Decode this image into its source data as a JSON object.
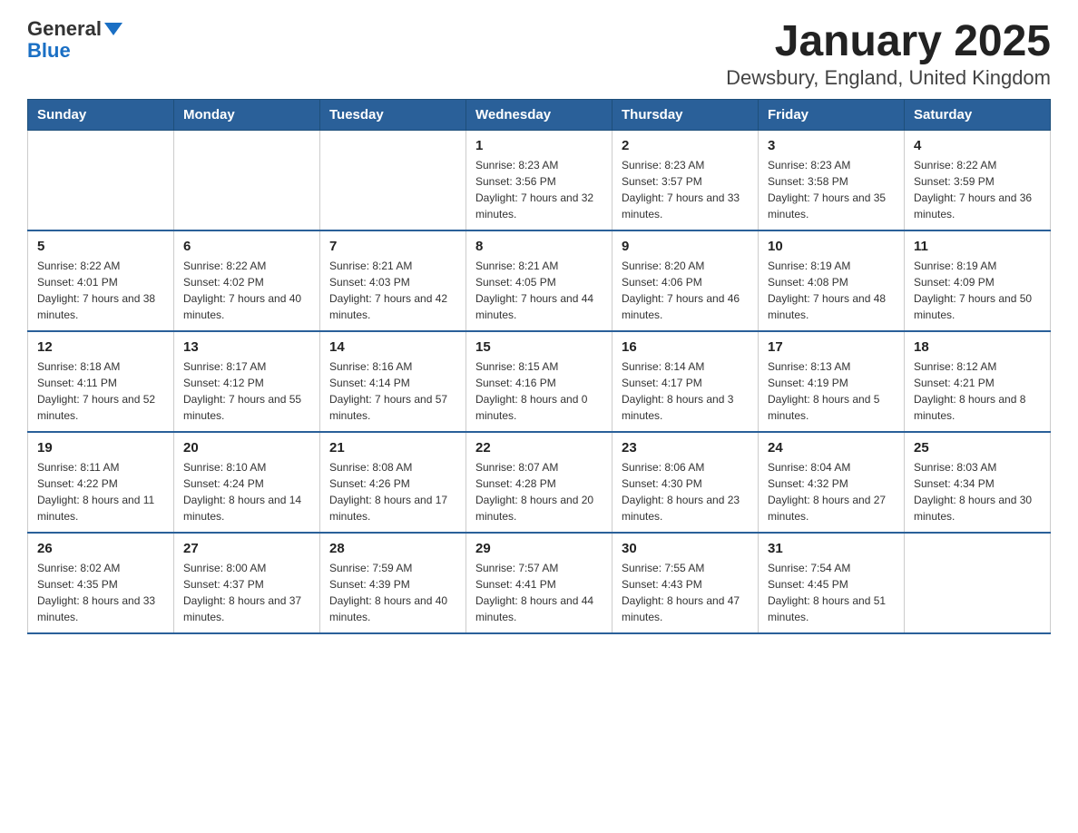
{
  "logo": {
    "general": "General",
    "blue": "Blue"
  },
  "title": "January 2025",
  "subtitle": "Dewsbury, England, United Kingdom",
  "days_of_week": [
    "Sunday",
    "Monday",
    "Tuesday",
    "Wednesday",
    "Thursday",
    "Friday",
    "Saturday"
  ],
  "weeks": [
    [
      {
        "day": "",
        "info": ""
      },
      {
        "day": "",
        "info": ""
      },
      {
        "day": "",
        "info": ""
      },
      {
        "day": "1",
        "info": "Sunrise: 8:23 AM\nSunset: 3:56 PM\nDaylight: 7 hours and 32 minutes."
      },
      {
        "day": "2",
        "info": "Sunrise: 8:23 AM\nSunset: 3:57 PM\nDaylight: 7 hours and 33 minutes."
      },
      {
        "day": "3",
        "info": "Sunrise: 8:23 AM\nSunset: 3:58 PM\nDaylight: 7 hours and 35 minutes."
      },
      {
        "day": "4",
        "info": "Sunrise: 8:22 AM\nSunset: 3:59 PM\nDaylight: 7 hours and 36 minutes."
      }
    ],
    [
      {
        "day": "5",
        "info": "Sunrise: 8:22 AM\nSunset: 4:01 PM\nDaylight: 7 hours and 38 minutes."
      },
      {
        "day": "6",
        "info": "Sunrise: 8:22 AM\nSunset: 4:02 PM\nDaylight: 7 hours and 40 minutes."
      },
      {
        "day": "7",
        "info": "Sunrise: 8:21 AM\nSunset: 4:03 PM\nDaylight: 7 hours and 42 minutes."
      },
      {
        "day": "8",
        "info": "Sunrise: 8:21 AM\nSunset: 4:05 PM\nDaylight: 7 hours and 44 minutes."
      },
      {
        "day": "9",
        "info": "Sunrise: 8:20 AM\nSunset: 4:06 PM\nDaylight: 7 hours and 46 minutes."
      },
      {
        "day": "10",
        "info": "Sunrise: 8:19 AM\nSunset: 4:08 PM\nDaylight: 7 hours and 48 minutes."
      },
      {
        "day": "11",
        "info": "Sunrise: 8:19 AM\nSunset: 4:09 PM\nDaylight: 7 hours and 50 minutes."
      }
    ],
    [
      {
        "day": "12",
        "info": "Sunrise: 8:18 AM\nSunset: 4:11 PM\nDaylight: 7 hours and 52 minutes."
      },
      {
        "day": "13",
        "info": "Sunrise: 8:17 AM\nSunset: 4:12 PM\nDaylight: 7 hours and 55 minutes."
      },
      {
        "day": "14",
        "info": "Sunrise: 8:16 AM\nSunset: 4:14 PM\nDaylight: 7 hours and 57 minutes."
      },
      {
        "day": "15",
        "info": "Sunrise: 8:15 AM\nSunset: 4:16 PM\nDaylight: 8 hours and 0 minutes."
      },
      {
        "day": "16",
        "info": "Sunrise: 8:14 AM\nSunset: 4:17 PM\nDaylight: 8 hours and 3 minutes."
      },
      {
        "day": "17",
        "info": "Sunrise: 8:13 AM\nSunset: 4:19 PM\nDaylight: 8 hours and 5 minutes."
      },
      {
        "day": "18",
        "info": "Sunrise: 8:12 AM\nSunset: 4:21 PM\nDaylight: 8 hours and 8 minutes."
      }
    ],
    [
      {
        "day": "19",
        "info": "Sunrise: 8:11 AM\nSunset: 4:22 PM\nDaylight: 8 hours and 11 minutes."
      },
      {
        "day": "20",
        "info": "Sunrise: 8:10 AM\nSunset: 4:24 PM\nDaylight: 8 hours and 14 minutes."
      },
      {
        "day": "21",
        "info": "Sunrise: 8:08 AM\nSunset: 4:26 PM\nDaylight: 8 hours and 17 minutes."
      },
      {
        "day": "22",
        "info": "Sunrise: 8:07 AM\nSunset: 4:28 PM\nDaylight: 8 hours and 20 minutes."
      },
      {
        "day": "23",
        "info": "Sunrise: 8:06 AM\nSunset: 4:30 PM\nDaylight: 8 hours and 23 minutes."
      },
      {
        "day": "24",
        "info": "Sunrise: 8:04 AM\nSunset: 4:32 PM\nDaylight: 8 hours and 27 minutes."
      },
      {
        "day": "25",
        "info": "Sunrise: 8:03 AM\nSunset: 4:34 PM\nDaylight: 8 hours and 30 minutes."
      }
    ],
    [
      {
        "day": "26",
        "info": "Sunrise: 8:02 AM\nSunset: 4:35 PM\nDaylight: 8 hours and 33 minutes."
      },
      {
        "day": "27",
        "info": "Sunrise: 8:00 AM\nSunset: 4:37 PM\nDaylight: 8 hours and 37 minutes."
      },
      {
        "day": "28",
        "info": "Sunrise: 7:59 AM\nSunset: 4:39 PM\nDaylight: 8 hours and 40 minutes."
      },
      {
        "day": "29",
        "info": "Sunrise: 7:57 AM\nSunset: 4:41 PM\nDaylight: 8 hours and 44 minutes."
      },
      {
        "day": "30",
        "info": "Sunrise: 7:55 AM\nSunset: 4:43 PM\nDaylight: 8 hours and 47 minutes."
      },
      {
        "day": "31",
        "info": "Sunrise: 7:54 AM\nSunset: 4:45 PM\nDaylight: 8 hours and 51 minutes."
      },
      {
        "day": "",
        "info": ""
      }
    ]
  ]
}
